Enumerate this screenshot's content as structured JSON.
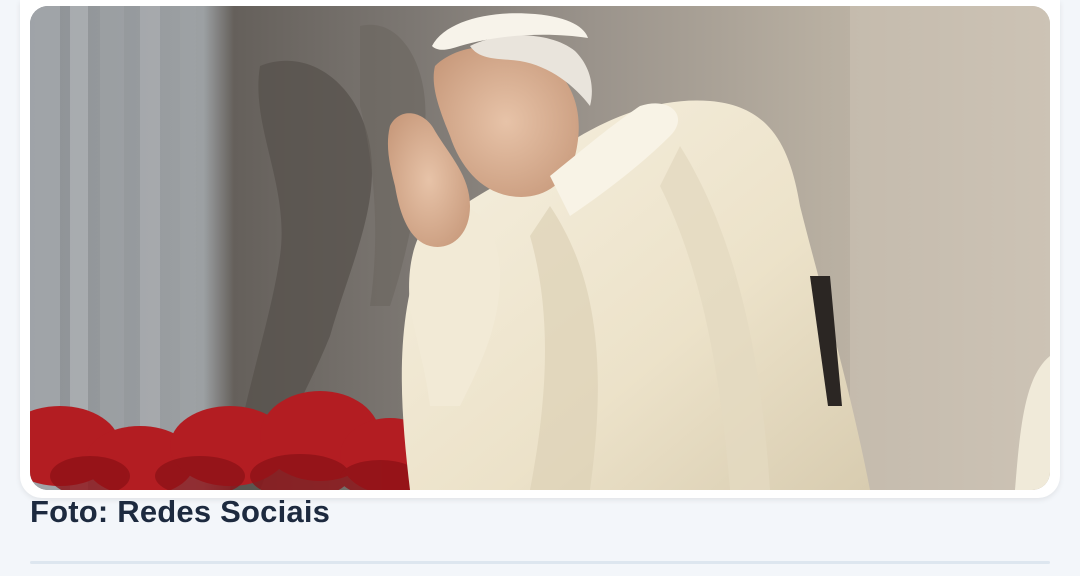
{
  "article": {
    "photo": {
      "subject": "pope-praying-photo"
    },
    "caption": "Foto: Redes Sociais"
  },
  "colors": {
    "caption_text": "#1d2a3f",
    "page_background": "#f3f6fa",
    "card_background": "#ffffff",
    "divider": "#dde6ef"
  }
}
